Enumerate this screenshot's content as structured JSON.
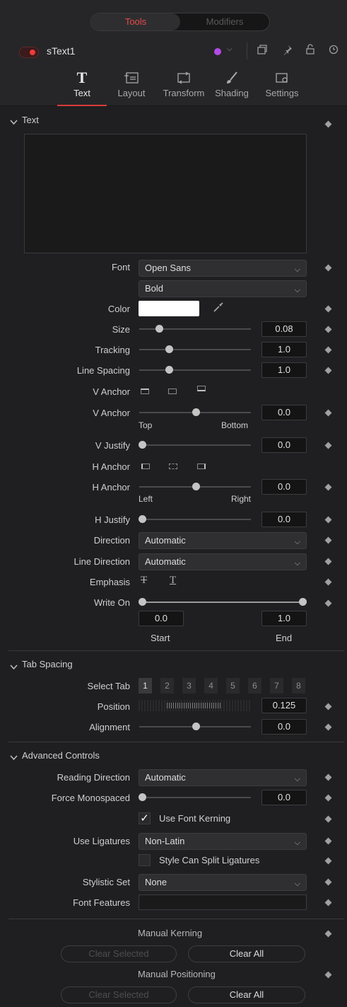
{
  "switch": {
    "tools": "Tools",
    "modifiers": "Modifiers"
  },
  "node": {
    "name": "sText1",
    "color_accent": "#b44ae6"
  },
  "tabs": [
    {
      "label": "Text",
      "icon": "text-T-icon"
    },
    {
      "label": "Layout",
      "icon": "layout-icon"
    },
    {
      "label": "Transform",
      "icon": "transform-icon"
    },
    {
      "label": "Shading",
      "icon": "brush-icon"
    },
    {
      "label": "Settings",
      "icon": "settings-icon"
    }
  ],
  "text_section": {
    "title": "Text",
    "font_label": "Font",
    "font_value": "Open Sans",
    "style_value": "Bold",
    "color_label": "Color",
    "size_label": "Size",
    "size_value": "0.08",
    "tracking_label": "Tracking",
    "tracking_value": "1.0",
    "line_spacing_label": "Line Spacing",
    "line_spacing_value": "1.0",
    "v_anchor_label": "V Anchor",
    "v_anchor2_label": "V Anchor",
    "v_anchor_value": "0.0",
    "v_top": "Top",
    "v_bottom": "Bottom",
    "v_justify_label": "V Justify",
    "v_justify_value": "0.0",
    "h_anchor_label": "H Anchor",
    "h_anchor2_label": "H Anchor",
    "h_anchor_value": "0.0",
    "h_left": "Left",
    "h_right": "Right",
    "h_justify_label": "H Justify",
    "h_justify_value": "0.0",
    "direction_label": "Direction",
    "direction_value": "Automatic",
    "line_direction_label": "Line Direction",
    "line_direction_value": "Automatic",
    "emphasis_label": "Emphasis",
    "write_on_label": "Write On",
    "write_start": "0.0",
    "write_end": "1.0",
    "start_label": "Start",
    "end_label": "End"
  },
  "tab_spacing": {
    "title": "Tab Spacing",
    "select_tab_label": "Select Tab",
    "tabs": [
      "1",
      "2",
      "3",
      "4",
      "5",
      "6",
      "7",
      "8"
    ],
    "position_label": "Position",
    "position_value": "0.125",
    "alignment_label": "Alignment",
    "alignment_value": "0.0"
  },
  "advanced": {
    "title": "Advanced Controls",
    "reading_direction_label": "Reading Direction",
    "reading_direction_value": "Automatic",
    "force_mono_label": "Force Monospaced",
    "force_mono_value": "0.0",
    "kerning_label": "Use Font Kerning",
    "ligatures_label": "Use Ligatures",
    "ligatures_value": "Non-Latin",
    "split_lig_label": "Style Can Split Ligatures",
    "stylistic_label": "Stylistic Set",
    "stylistic_value": "None",
    "font_features_label": "Font Features"
  },
  "manual": {
    "kerning_label": "Manual Kerning",
    "positioning_label": "Manual Positioning",
    "clear_selected": "Clear Selected",
    "clear_all": "Clear All"
  }
}
